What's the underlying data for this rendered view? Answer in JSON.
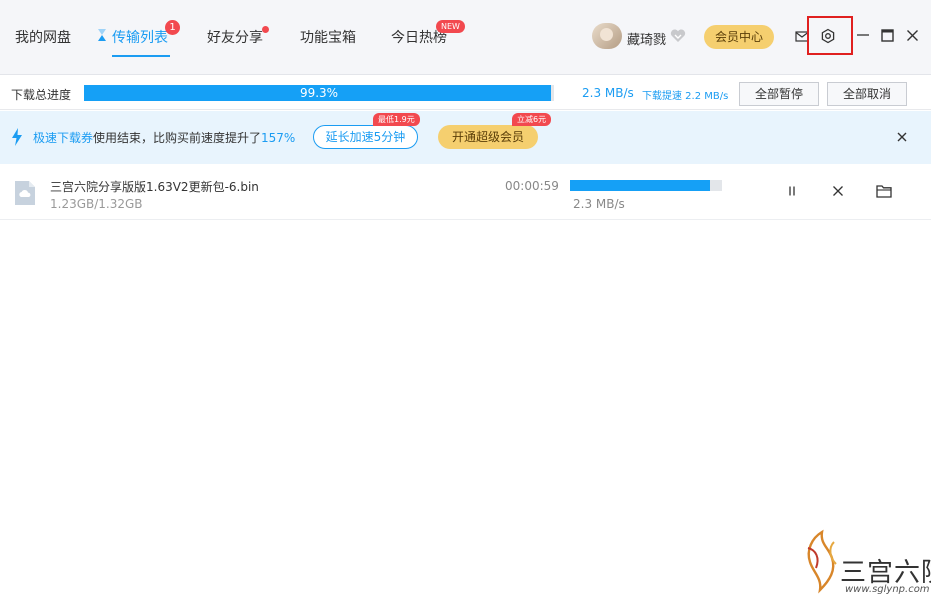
{
  "nav": {
    "tabs": [
      {
        "label": "我的网盘"
      },
      {
        "label": "传输列表",
        "badge": "1"
      },
      {
        "label": "好友分享"
      },
      {
        "label": "功能宝箱"
      },
      {
        "label": "今日热榜",
        "badge": "NEW"
      }
    ],
    "active_tab": "传输列表",
    "user": {
      "name": "藏琦戮"
    },
    "member_center_label": "会员中心",
    "icons": [
      "loading-icon",
      "mail-icon",
      "settings-icon",
      "minimize-icon",
      "maximize-icon",
      "close-icon"
    ]
  },
  "progress": {
    "label": "下载总进度",
    "percent_text": "99.3%",
    "percent": 99.3,
    "speed": "2.3 MB/s",
    "boost_speed": "下载提速 2.2 MB/s",
    "pause_all_label": "全部暂停",
    "cancel_all_label": "全部取消"
  },
  "promo": {
    "highlight_1": "极速下载券",
    "text_mid": "使用结束，比购买前速度提升了",
    "highlight_2": "157%",
    "extend_label": "延长加速5分钟",
    "extend_tag": "最低1.9元",
    "vip_label": "开通超级会员",
    "vip_tag": "立减6元"
  },
  "file": {
    "name": "三宫六院分享版版1.63V2更新包-6.bin",
    "size": "1.23GB/1.32GB",
    "time_left": "00:00:59",
    "speed": "2.3 MB/s",
    "progress": 0.92
  },
  "watermark": {
    "title": "三宫六院",
    "url": "www.sglynp.com"
  },
  "colors": {
    "accent": "#1b9cf2",
    "gold": "#f5cf6f",
    "red": "#f2494f"
  }
}
